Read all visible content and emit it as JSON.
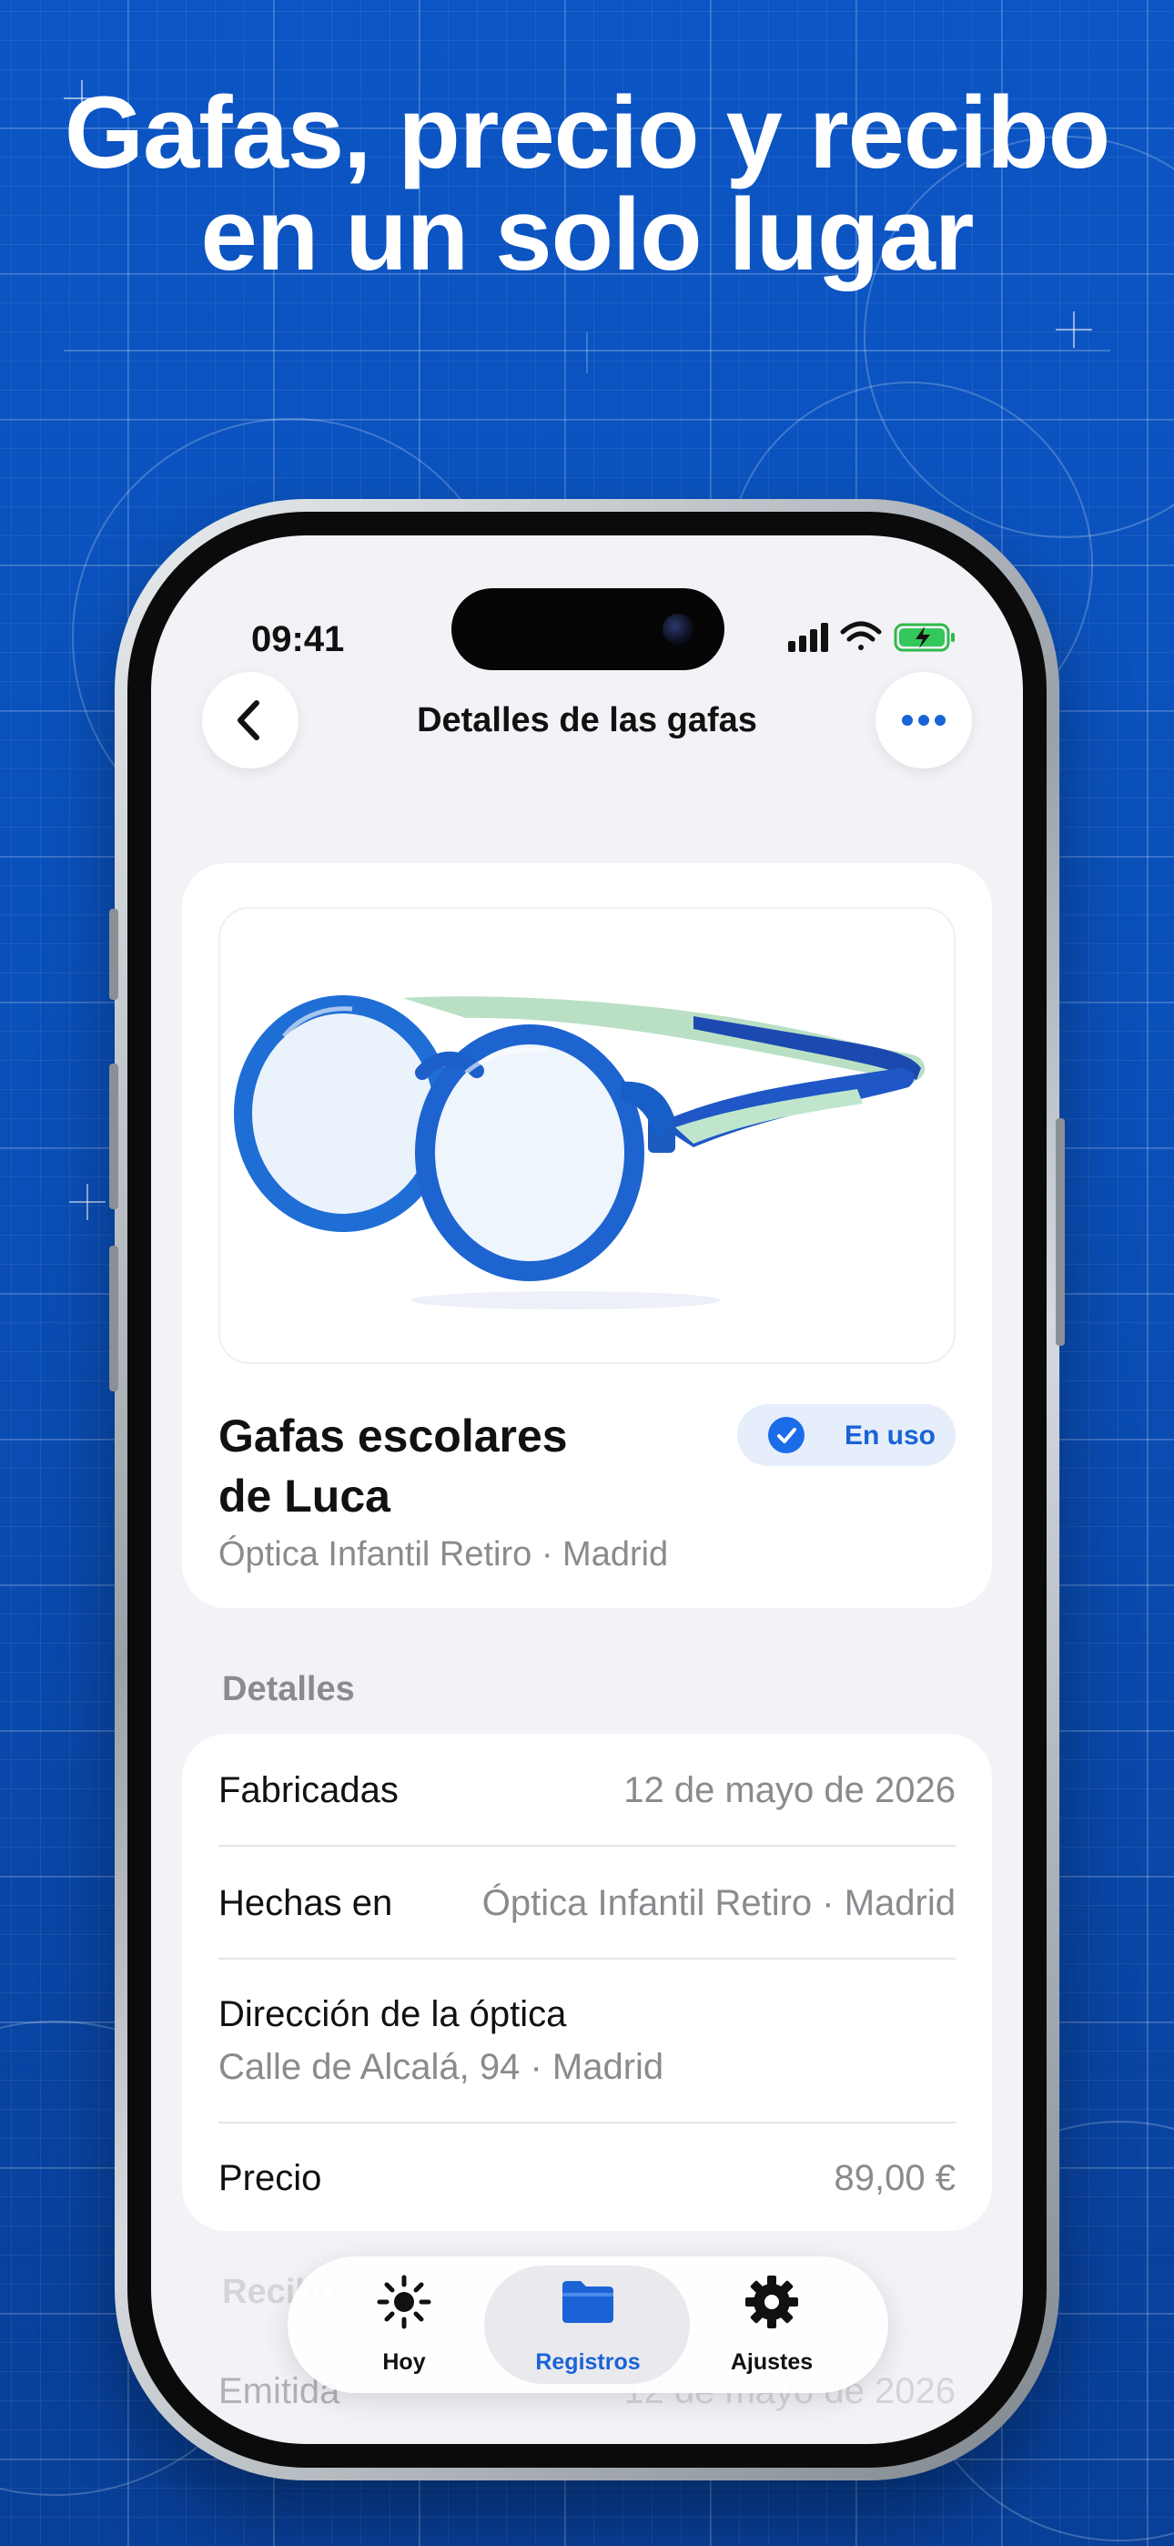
{
  "headline": {
    "line1": "Gafas, precio y recibo",
    "line2": "en un solo lugar"
  },
  "status_bar": {
    "time": "09:41"
  },
  "nav": {
    "back_icon": "chevron-left-icon",
    "title": "Detalles de las gafas",
    "more_icon": "ellipsis-icon"
  },
  "product": {
    "image": "blue-kids-glasses-photo",
    "name_line1": "Gafas escolares",
    "name_line2": "de Luca",
    "subtitle": "Óptica Infantil Retiro · Madrid",
    "badge_label": "En uso"
  },
  "details": {
    "heading": "Detalles",
    "made_label": "Fabricadas",
    "made_value": "12 de mayo de 2026",
    "madein_label": "Hechas en",
    "madein_value": "Óptica Infantil Retiro · Madrid",
    "address_label": "Dirección de la óptica",
    "address_value": "Calle de Alcalá, 94 · Madrid",
    "price_label": "Precio",
    "price_value": "89,00 €"
  },
  "receipt": {
    "heading": "Recibo",
    "issued_label": "Emitida",
    "issued_value": "12 de mayo de 2026"
  },
  "tabs": [
    {
      "label": "Hoy",
      "icon": "sun-icon",
      "active": false
    },
    {
      "label": "Registros",
      "icon": "folder-icon",
      "active": true
    },
    {
      "label": "Ajustes",
      "icon": "gear-icon",
      "active": false
    }
  ],
  "colors": {
    "background": "#0a4fb8",
    "accent": "#1a63d6",
    "screen_bg": "#f2f2f7"
  }
}
